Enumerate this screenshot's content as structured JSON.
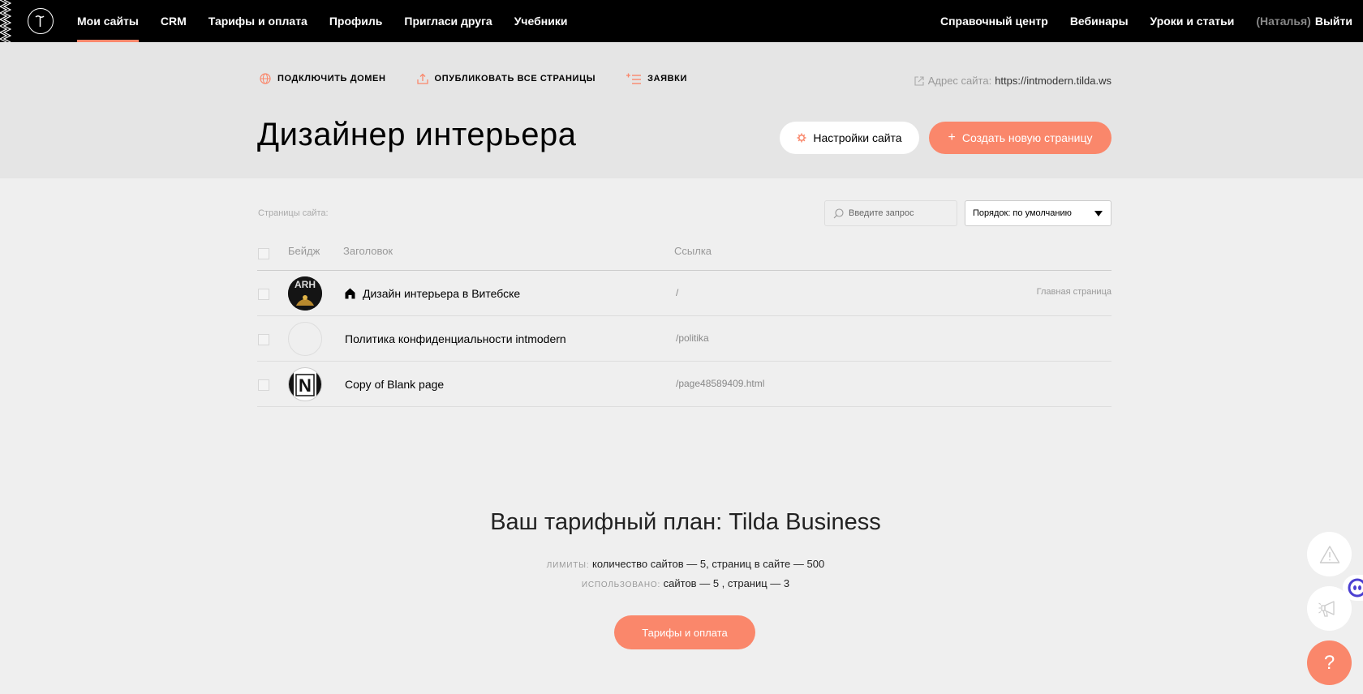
{
  "nav": {
    "left": [
      {
        "label": "Мои сайты",
        "active": true
      },
      {
        "label": "CRM"
      },
      {
        "label": "Тарифы и оплата"
      },
      {
        "label": "Профиль"
      },
      {
        "label": "Пригласи друга"
      },
      {
        "label": "Учебники"
      }
    ],
    "right": [
      {
        "label": "Справочный центр"
      },
      {
        "label": "Вебинары"
      },
      {
        "label": "Уроки и статьи"
      }
    ],
    "user": "(Наталья)",
    "logout": "Выйти"
  },
  "actions": {
    "connect_domain": "ПОДКЛЮЧИТЬ ДОМЕН",
    "publish_all": "ОПУБЛИКОВАТЬ ВСЕ СТРАНИЦЫ",
    "requests": "ЗАЯВКИ"
  },
  "site": {
    "address_label": "Адрес сайта:",
    "address": "https://intmodern.tilda.ws",
    "title": "Дизайнер интерьера",
    "settings_button": "Настройки сайта",
    "create_button": "Создать новую страницу"
  },
  "pages": {
    "label": "Страницы сайта:",
    "search_placeholder": "Введите запрос",
    "sort_label": "Порядок: по умолчанию",
    "columns": {
      "badge": "Бейдж",
      "title": "Заголовок",
      "link": "Ссылка"
    },
    "rows": [
      {
        "title": "Дизайн интерьера в Витебске",
        "link": "/",
        "note": "Главная страница",
        "badge_text": "ARH"
      },
      {
        "title": "Политика конфиденциальности intmodern",
        "link": "/politika",
        "note": ""
      },
      {
        "title": "Copy of Blank page",
        "link": "/page48589409.html",
        "note": "",
        "badge_text": "N"
      }
    ]
  },
  "plan": {
    "title": "Ваш тарифный план: Tilda Business",
    "limits_caption": "ЛИМИТЫ:",
    "limits_text": "количество сайтов — 5, страниц в сайте — 500",
    "used_caption": "ИСПОЛЬЗОВАНО:",
    "used_text": "сайтов — 5 , страниц — 3",
    "button": "Тарифы и оплата"
  },
  "help_glyph": "?",
  "colors": {
    "accent": "#fa876b",
    "nav_bg": "#000000",
    "band_bg": "#e5e5e5",
    "page_bg": "#efefef"
  },
  "icons": [
    "tilda-logo-icon",
    "globe-icon",
    "upload-icon",
    "list-add-icon",
    "external-link-icon",
    "gear-icon",
    "plus-icon",
    "search-icon",
    "home-icon",
    "warning-icon",
    "megaphone-icon"
  ]
}
